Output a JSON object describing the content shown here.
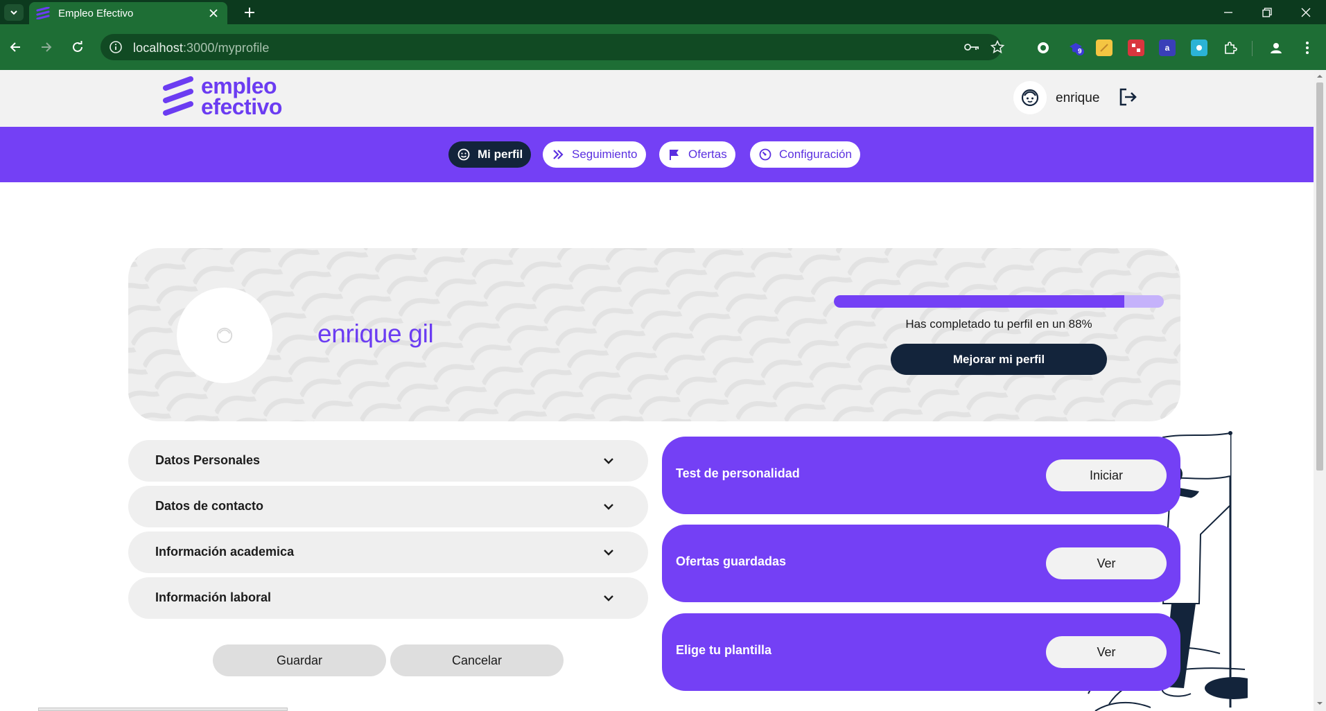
{
  "browser": {
    "tab_title": "Empleo Efectivo",
    "url_host": "localhost",
    "url_path": ":3000/myprofile",
    "extension_badge": "9",
    "accent_color": "#1e6e35"
  },
  "header": {
    "logo_line1": "empleo",
    "logo_line2": "efectivo",
    "user_name": "enrique"
  },
  "nav": {
    "items": [
      {
        "label": "Mi perfil",
        "icon": "smile-icon",
        "active": true
      },
      {
        "label": "Seguimiento",
        "icon": "double-chevron-right-icon",
        "active": false
      },
      {
        "label": "Ofertas",
        "icon": "flag-icon",
        "active": false
      },
      {
        "label": "Configuración",
        "icon": "gauge-icon",
        "active": false
      }
    ]
  },
  "profile": {
    "full_name": "enrique gil",
    "completion_percent": 88,
    "completion_text": "Has completado tu perfil en un 88%",
    "improve_label": "Mejorar mi perfil"
  },
  "sections": [
    {
      "label": "Datos Personales"
    },
    {
      "label": "Datos de contacto"
    },
    {
      "label": "Información academica"
    },
    {
      "label": "Información laboral"
    }
  ],
  "form": {
    "save_label": "Guardar",
    "cancel_label": "Cancelar"
  },
  "actions": [
    {
      "label": "Test de personalidad",
      "button": "Iniciar"
    },
    {
      "label": "Ofertas guardadas",
      "button": "Ver"
    },
    {
      "label": "Elige tu plantilla",
      "button": "Ver"
    }
  ],
  "colors": {
    "brand_purple": "#7440f5",
    "dark_navy": "#13243b",
    "light_gray": "#efefef"
  }
}
